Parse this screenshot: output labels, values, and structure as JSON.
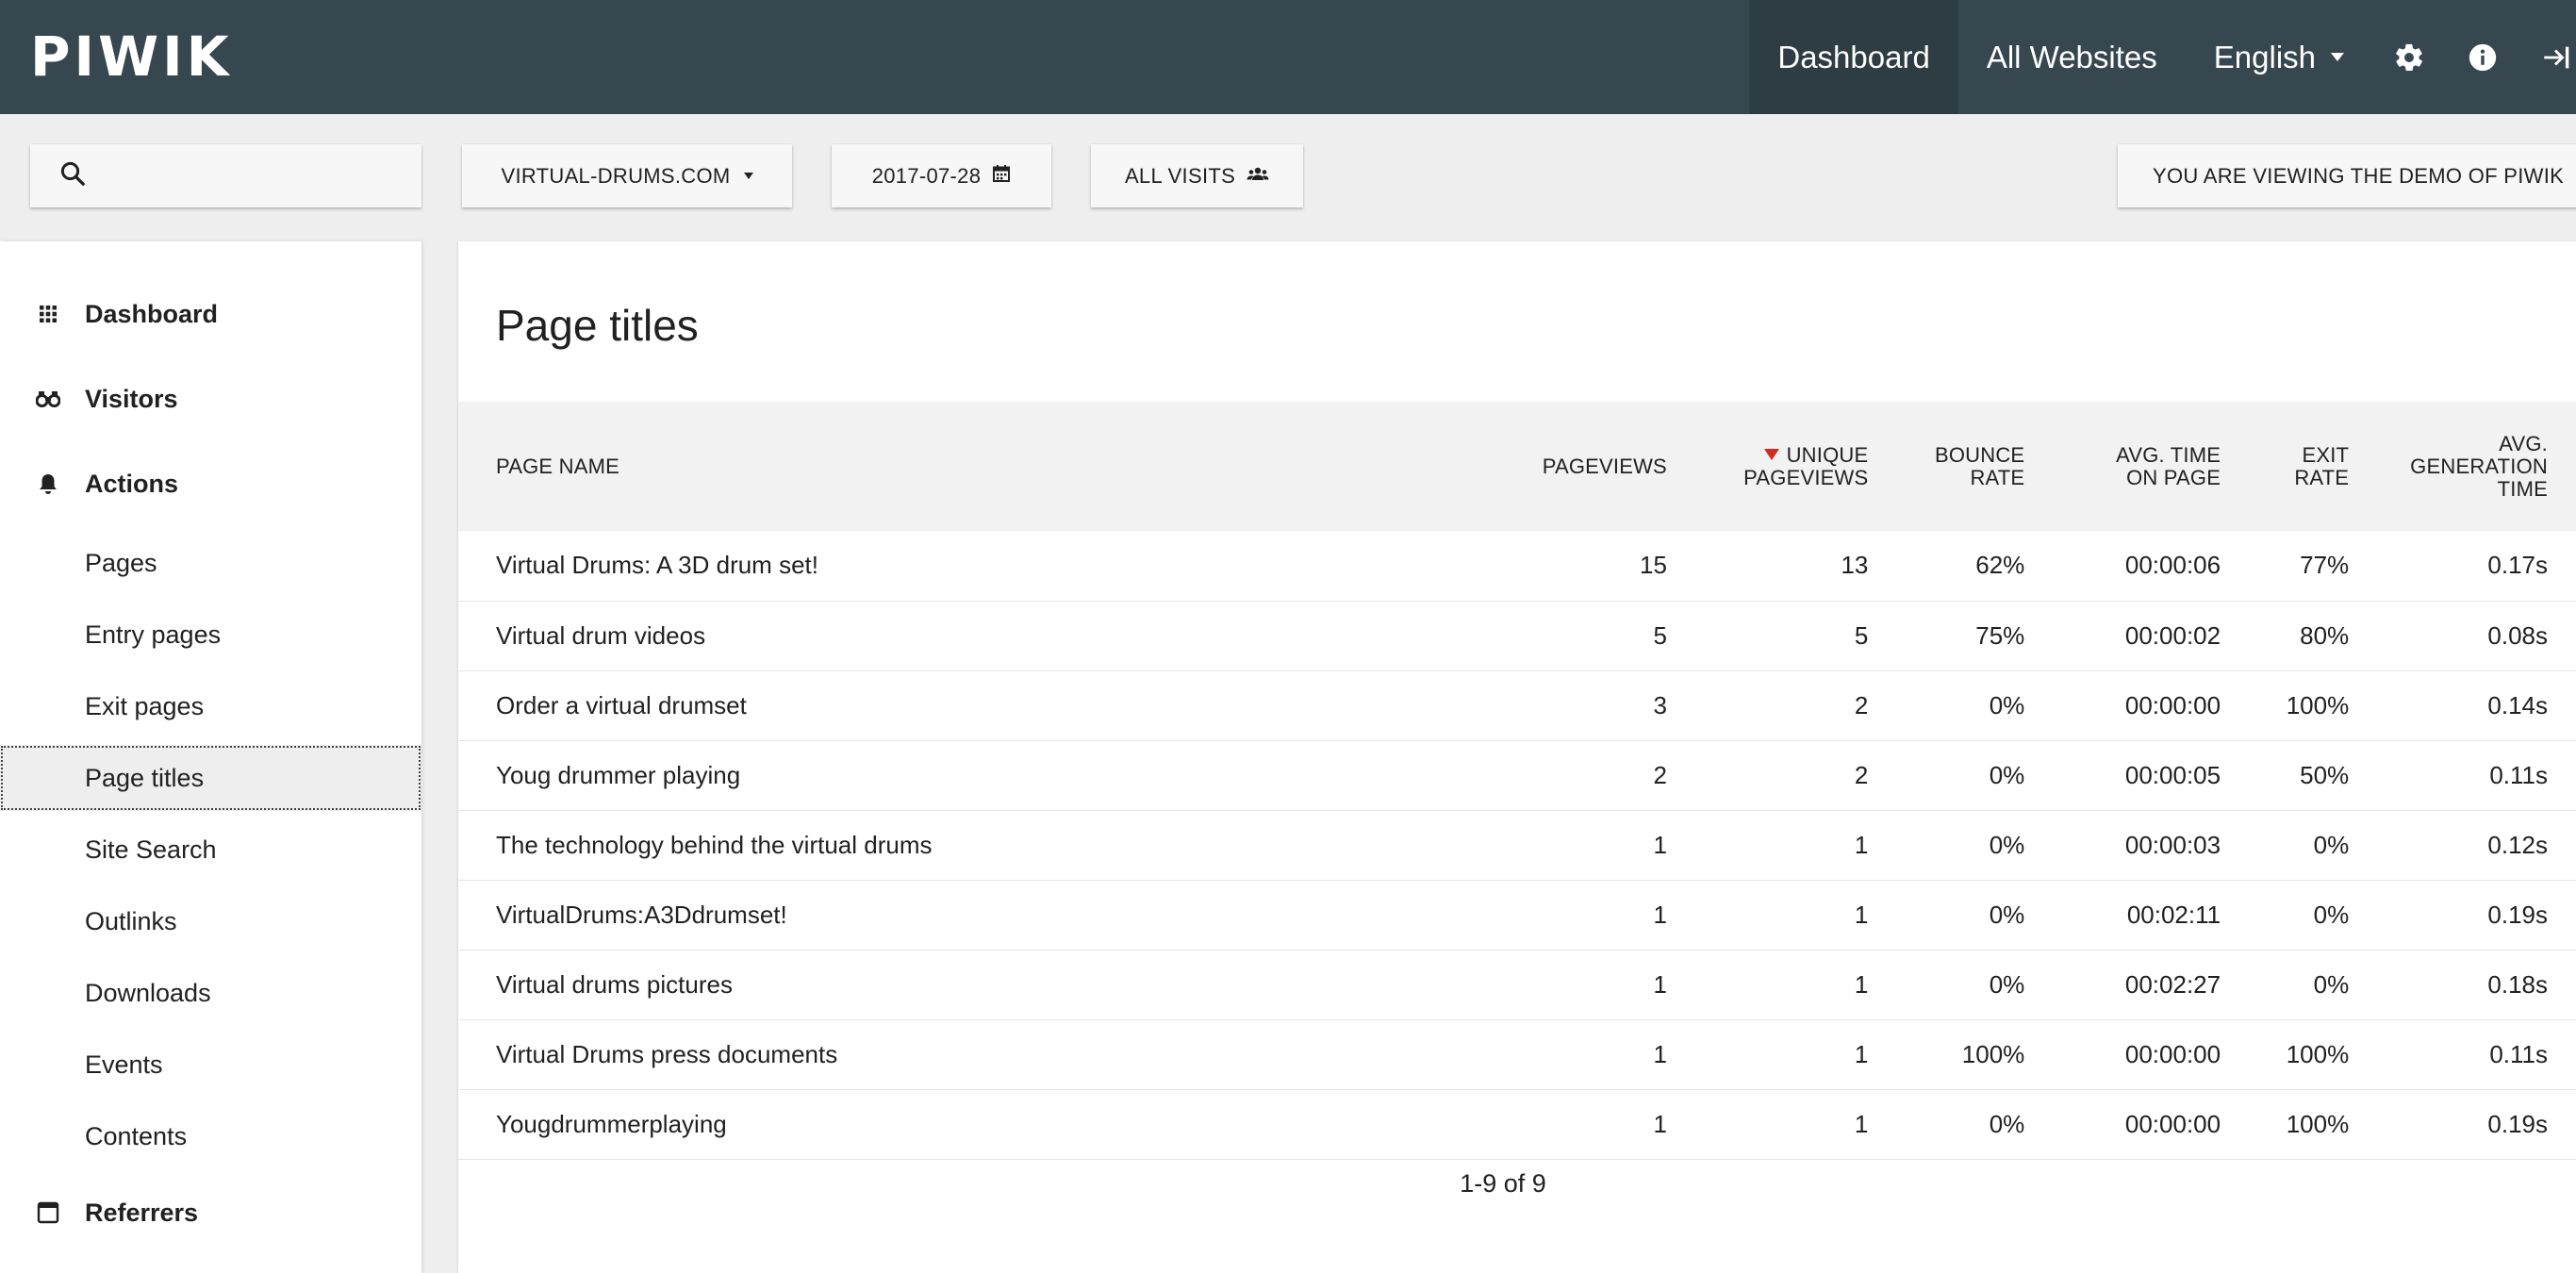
{
  "app": {
    "logo": "PIWIK"
  },
  "topnav": {
    "dashboard": "Dashboard",
    "all_websites": "All Websites",
    "language": "English",
    "settings_icon": "gear-icon",
    "info_icon": "info-icon",
    "logout_icon": "sign-out-icon"
  },
  "filters": {
    "search_icon": "search-icon",
    "site": "VIRTUAL-DRUMS.COM",
    "date": "2017-07-28",
    "segment": "ALL VISITS",
    "demo_notice": "YOU ARE VIEWING THE DEMO OF PIWIK"
  },
  "sidebar": {
    "categories": {
      "dashboard": "Dashboard",
      "visitors": "Visitors",
      "actions": "Actions",
      "referrers": "Referrers"
    },
    "actions_items": [
      "Pages",
      "Entry pages",
      "Exit pages",
      "Page titles",
      "Site Search",
      "Outlinks",
      "Downloads",
      "Events",
      "Contents"
    ],
    "active_item": "Page titles"
  },
  "report": {
    "title": "Page titles",
    "columns": {
      "page_name": "PAGE NAME",
      "pageviews": "PAGEVIEWS",
      "unique_pageviews_1": "UNIQUE",
      "unique_pageviews_2": "PAGEVIEWS",
      "bounce_rate_1": "BOUNCE",
      "bounce_rate_2": "RATE",
      "avg_time_1": "AVG. TIME",
      "avg_time_2": "ON PAGE",
      "exit_rate_1": "EXIT",
      "exit_rate_2": "RATE",
      "avg_gen_1": "AVG.",
      "avg_gen_2": "GENERATION",
      "avg_gen_3": "TIME"
    },
    "sorted_by": "UNIQUE PAGEVIEWS",
    "rows": [
      [
        "Virtual Drums: A 3D drum set!",
        "15",
        "13",
        "62%",
        "00:00:06",
        "77%",
        "0.17s"
      ],
      [
        "Virtual drum videos",
        "5",
        "5",
        "75%",
        "00:00:02",
        "80%",
        "0.08s"
      ],
      [
        "Order a virtual drumset",
        "3",
        "2",
        "0%",
        "00:00:00",
        "100%",
        "0.14s"
      ],
      [
        "Youg drummer playing",
        "2",
        "2",
        "0%",
        "00:00:05",
        "50%",
        "0.11s"
      ],
      [
        "The technology behind the virtual drums",
        "1",
        "1",
        "0%",
        "00:00:03",
        "0%",
        "0.12s"
      ],
      [
        "VirtualDrums:A3Ddrumset!",
        "1",
        "1",
        "0%",
        "00:02:11",
        "0%",
        "0.19s"
      ],
      [
        "Virtual drums pictures",
        "1",
        "1",
        "0%",
        "00:02:27",
        "0%",
        "0.18s"
      ],
      [
        "Virtual Drums press documents",
        "1",
        "1",
        "100%",
        "00:00:00",
        "100%",
        "0.11s"
      ],
      [
        "Yougdrummerplaying",
        "1",
        "1",
        "0%",
        "00:00:00",
        "100%",
        "0.19s"
      ]
    ],
    "pagination": "1-9 of 9"
  }
}
